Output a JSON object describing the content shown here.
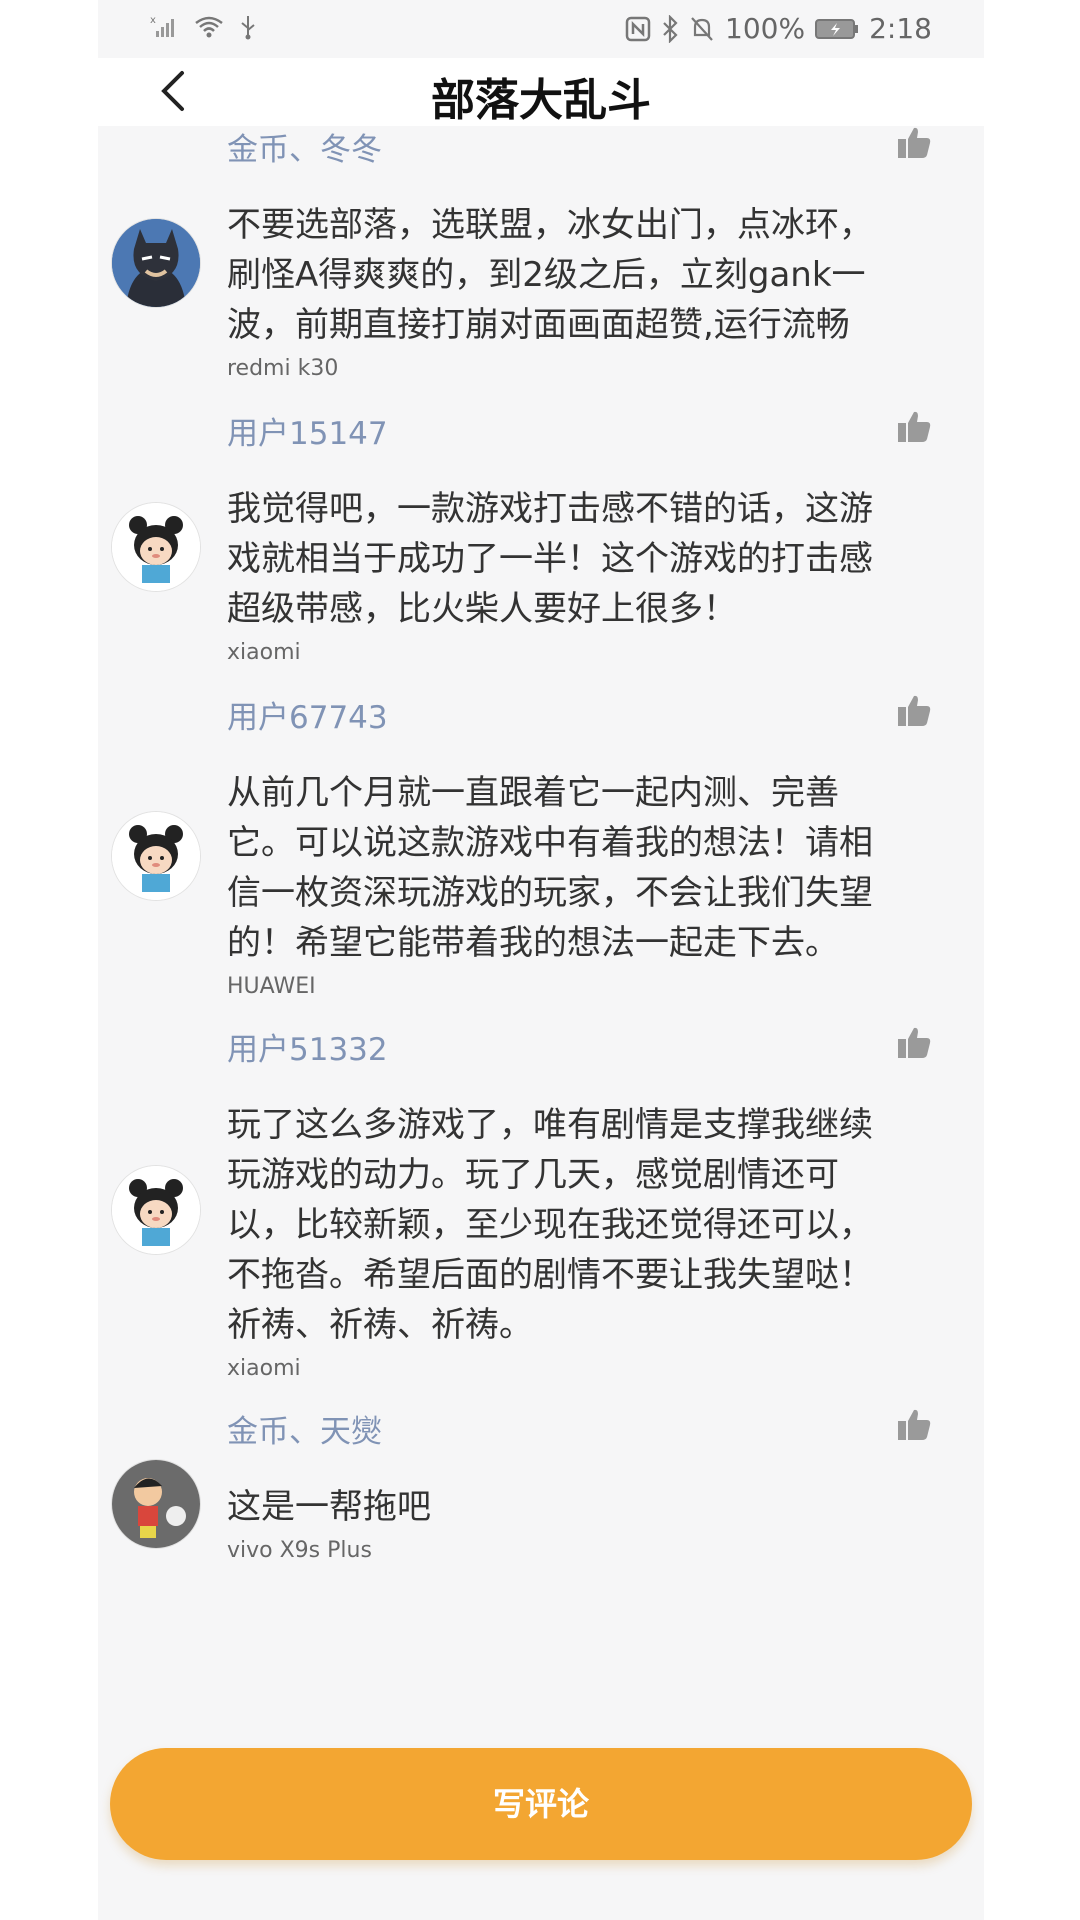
{
  "status_bar": {
    "battery_text": "100%",
    "time": "2:18"
  },
  "header": {
    "title": "部落大乱斗"
  },
  "comments": [
    {
      "user": "金币、冬冬",
      "text_lines": [
        "不要选部落，选联盟，冰女出门，点冰环，",
        "刷怪A得爽爽的，到2级之后，立刻gank一",
        "波，前期直接打崩对面画面超赞,运行流畅"
      ],
      "device": "redmi k30",
      "avatar": "batman-avatar-icon"
    },
    {
      "user": "用户15147",
      "text_lines": [
        "我觉得吧，一款游戏打击感不错的话，这游",
        "戏就相当于成功了一半！这个游戏的打击感",
        "超级带感，比火柴人要好上很多！"
      ],
      "device": "xiaomi",
      "avatar": "panda-boy-avatar-icon"
    },
    {
      "user": "用户67743",
      "text_lines": [
        "从前几个月就一直跟着它一起内测、完善",
        "它。可以说这款游戏中有着我的想法！请相",
        "信一枚资深玩游戏的玩家，不会让我们失望",
        "的！希望它能带着我的想法一起走下去。"
      ],
      "device": "HUAWEI",
      "avatar": "panda-boy-avatar-icon"
    },
    {
      "user": "用户51332",
      "text_lines": [
        "玩了这么多游戏了，唯有剧情是支撑我继续",
        "玩游戏的动力。玩了几天，感觉剧情还可",
        "以，比较新颖，至少现在我还觉得还可以，",
        "不拖沓。希望后面的剧情不要让我失望哒！",
        "祈祷、祈祷、祈祷。"
      ],
      "device": "xiaomi",
      "avatar": "panda-boy-avatar-icon"
    },
    {
      "user": "金币、天爕",
      "text_lines": [
        "这是一帮拖吧"
      ],
      "device": "vivo X9s Plus",
      "avatar": "crayon-shin-avatar-icon"
    }
  ],
  "bottom": {
    "write_review_label": "写评论"
  },
  "colors": {
    "accent": "#f3a632",
    "username": "#8093b5"
  }
}
